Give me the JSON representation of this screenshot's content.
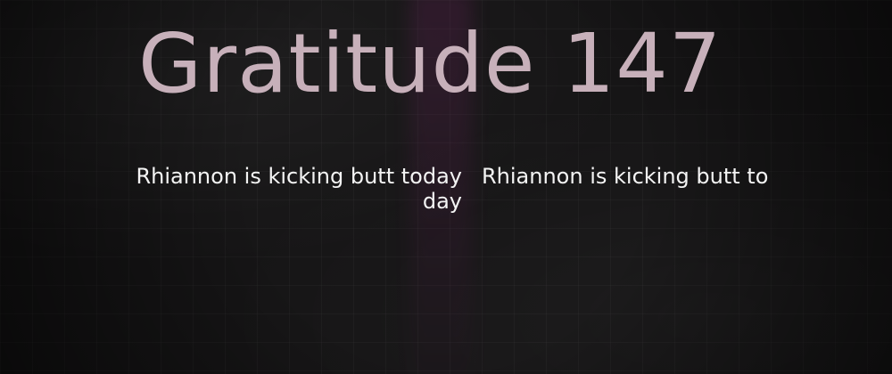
{
  "header": {
    "title": "Gratitude 147"
  },
  "content": {
    "line_1": "Rhiannon is kicking butt today",
    "line_2": "Rhiannon is kicking butt to",
    "line_1_wrap": "day"
  }
}
